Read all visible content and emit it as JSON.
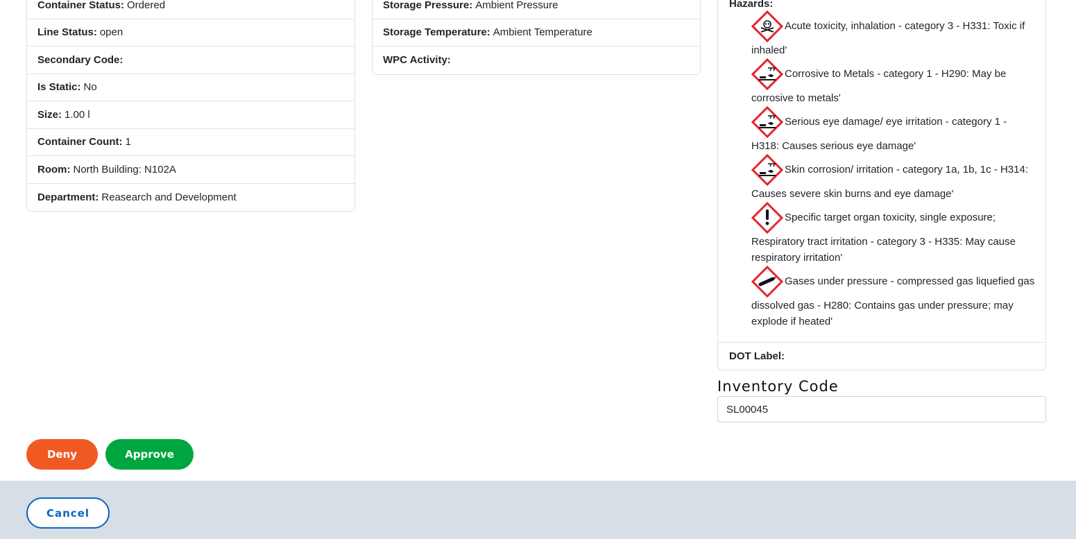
{
  "left_details": [
    {
      "label": "Container Status:",
      "value": "Ordered"
    },
    {
      "label": "Line Status:",
      "value": "open"
    },
    {
      "label": "Secondary Code:",
      "value": ""
    },
    {
      "label": "Is Static:",
      "value": "No"
    },
    {
      "label": "Size:",
      "value": "1.00 l"
    },
    {
      "label": "Container Count:",
      "value": "1"
    },
    {
      "label": "Room:",
      "value": "North Building: N102A"
    },
    {
      "label": "Department:",
      "value": "Reasearch and Development"
    }
  ],
  "mid_details": [
    {
      "label": "Storage Pressure:",
      "value": "Ambient Pressure"
    },
    {
      "label": "Storage Temperature:",
      "value": "Ambient Temperature"
    },
    {
      "label": "WPC Activity:",
      "value": ""
    }
  ],
  "hazards": {
    "title": "Hazards:",
    "items": [
      {
        "icon": "skull-crossbones-icon",
        "text": "Acute toxicity, inhalation - category 3 - H331: Toxic if inhaled'"
      },
      {
        "icon": "corrosion-icon",
        "text": "Corrosive to Metals - category 1 - H290: May be corrosive to metals'"
      },
      {
        "icon": "corrosion-icon",
        "text": "Serious eye damage/ eye irritation - category 1 - H318: Causes serious eye damage'"
      },
      {
        "icon": "corrosion-icon",
        "text": "Skin corrosion/ irritation - category 1a, 1b, 1c - H314: Causes severe skin burns and eye damage'"
      },
      {
        "icon": "exclamation-mark-icon",
        "text": "Specific target organ toxicity, single exposure; Respiratory tract irritation - category 3 - H335: May cause respiratory irritation'"
      },
      {
        "icon": "gas-cylinder-icon",
        "text": "Gases under pressure - compressed gas liquefied gas dissolved gas - H280: Contains gas under pressure; may explode if heated'"
      }
    ]
  },
  "dot_label": {
    "label": "DOT Label:",
    "value": ""
  },
  "inventory": {
    "label": "Inventory Code",
    "value": "SL00045"
  },
  "actions": {
    "deny": "Deny",
    "approve": "Approve",
    "cancel": "Cancel"
  },
  "colors": {
    "deny": "#f05a22",
    "approve": "#00a63f",
    "cancel": "#0a66c2",
    "ghs_red": "#e3242b",
    "footer": "#d8dee6"
  }
}
